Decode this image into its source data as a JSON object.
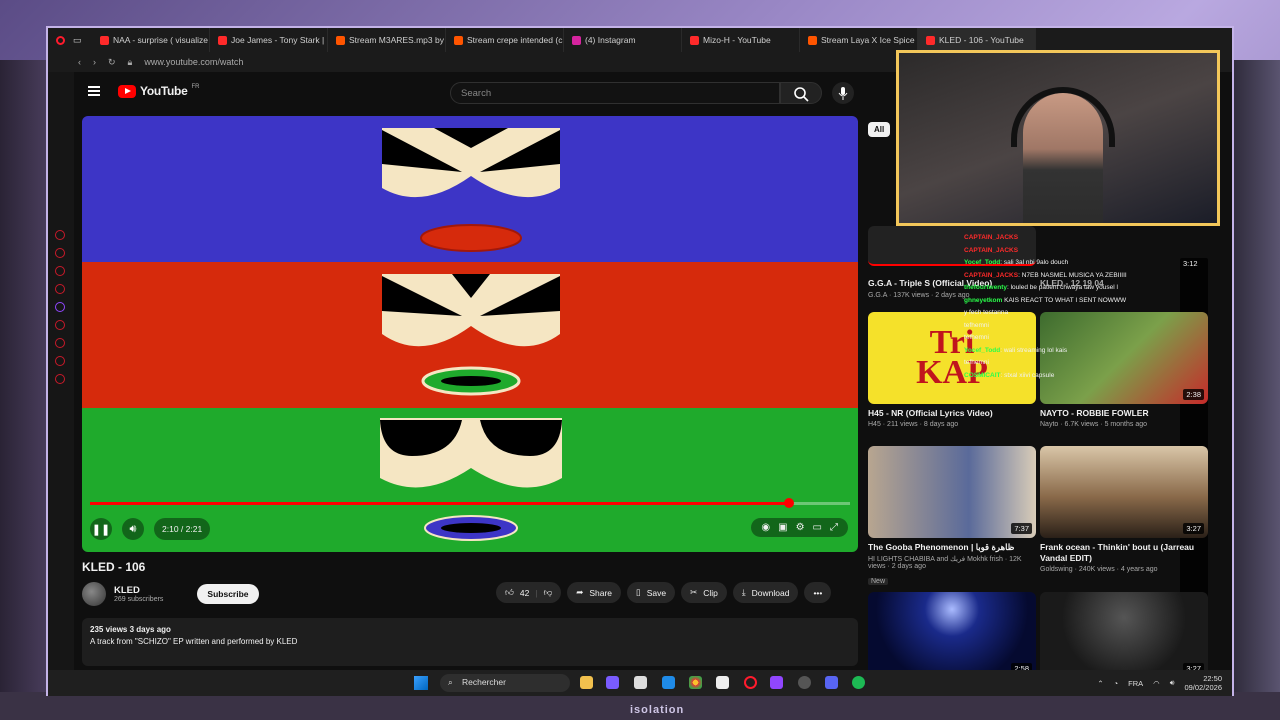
{
  "browser": {
    "tabs": [
      {
        "label": "NAA - surprise ( visualize",
        "color": "#ff2a2a"
      },
      {
        "label": "Joe James - Tony Stark | ",
        "color": "#ff2a2a"
      },
      {
        "label": "Stream M3ARES.mp3 by A",
        "color": "#ff5500"
      },
      {
        "label": "Stream crepe intended (c",
        "color": "#ff5500"
      },
      {
        "label": "(4) Instagram",
        "color": "#d6249f"
      },
      {
        "label": "Mizo-H - YouTube",
        "color": "#ff2a2a"
      },
      {
        "label": "Stream Laya X Ice Spice",
        "color": "#ff5500"
      },
      {
        "label": "KLED - 106 - YouTube",
        "color": "#ff2a2a"
      }
    ],
    "url": "www.youtube.com/watch"
  },
  "youtube": {
    "logo_text": "YouTube",
    "country": "FR",
    "search_placeholder": "Search",
    "player": {
      "current_time": "2:10",
      "duration": "2:21",
      "time_display": "2:10 / 2:21",
      "progress": 0.92
    },
    "video": {
      "title": "KLED - 106",
      "channel": "KLED",
      "subscribers": "269 subscribers",
      "subscribe_label": "Subscribe",
      "likes": "42",
      "share_label": "Share",
      "save_label": "Save",
      "clip_label": "Clip",
      "download_label": "Download",
      "stats": "235 views  3 days ago",
      "description": "A track from \"SCHIZO\" EP written and performed by KLED"
    },
    "chip_all": "All",
    "related": [
      {
        "title": "G.G.A - Triple S (Official Video)",
        "meta": "G.G.A · 137K views · 2 days ago",
        "duration": "3:12"
      },
      {
        "title": "KLED - 12 19 04",
        "meta": "",
        "duration": ""
      },
      {
        "title": "H45 - NR (Official Lyrics Video)",
        "meta": "H45 · 211 views · 8 days ago",
        "duration": ""
      },
      {
        "title": "NAYTO - ROBBIE FOWLER",
        "meta": "Nayto · 6.7K views · 5 months ago",
        "duration": "2:38"
      },
      {
        "title": "The Gooba Phenomenon | ظاهرة قوبا",
        "meta": "HI LIGHTS CHABIBA and فريك Mokhk frish · 12K views · 2 days ago",
        "badge": "New",
        "duration": "7:37"
      },
      {
        "title": "Frank ocean - Thinkin' bout u (Jarreau Vandal EDIT)",
        "meta": "Goldswing · 240K views · 4 years ago",
        "duration": "3:27"
      },
      {
        "title": "",
        "meta": "",
        "duration": "2:58"
      },
      {
        "title": "",
        "meta": "",
        "duration": "3:27"
      }
    ],
    "thumb_text": "Tri\nKAP"
  },
  "chat": [
    {
      "user": "CAPTAIN_JACKS",
      "msg": ""
    },
    {
      "user": "CAPTAIN_JACKS",
      "msg": ""
    },
    {
      "user": "Yocef_Todd",
      "msg": "sali 3al nbi 9alo douch"
    },
    {
      "user": "CAPTAIN_JACKS",
      "msg": "N7EB NASMEL MUSICA YA ZEBIIIII"
    },
    {
      "user": "thefourtwenty",
      "msg": "louled be patient chwaya taw yousel l"
    },
    {
      "user": "ghneyetkom",
      "msg": "KAIS REACT TO WHAT I SENT NOWWW"
    },
    {
      "user": "",
      "msg": "y fech testanna"
    },
    {
      "user": "",
      "msg": "tefhemni"
    },
    {
      "user": "",
      "msg": "tefhemni"
    },
    {
      "user": "Yocef_Todd",
      "msg": "wali streaming lol kais"
    },
    {
      "user": "",
      "msg": "tefhemni"
    },
    {
      "user": "COSMICAIT",
      "msg": "stxal xiivi capsule"
    }
  ],
  "taskbar": {
    "search_label": "Rechercher",
    "lang": "FRA",
    "time": "22:50",
    "date": "09/02/2026"
  },
  "overlay_text": "isolation"
}
